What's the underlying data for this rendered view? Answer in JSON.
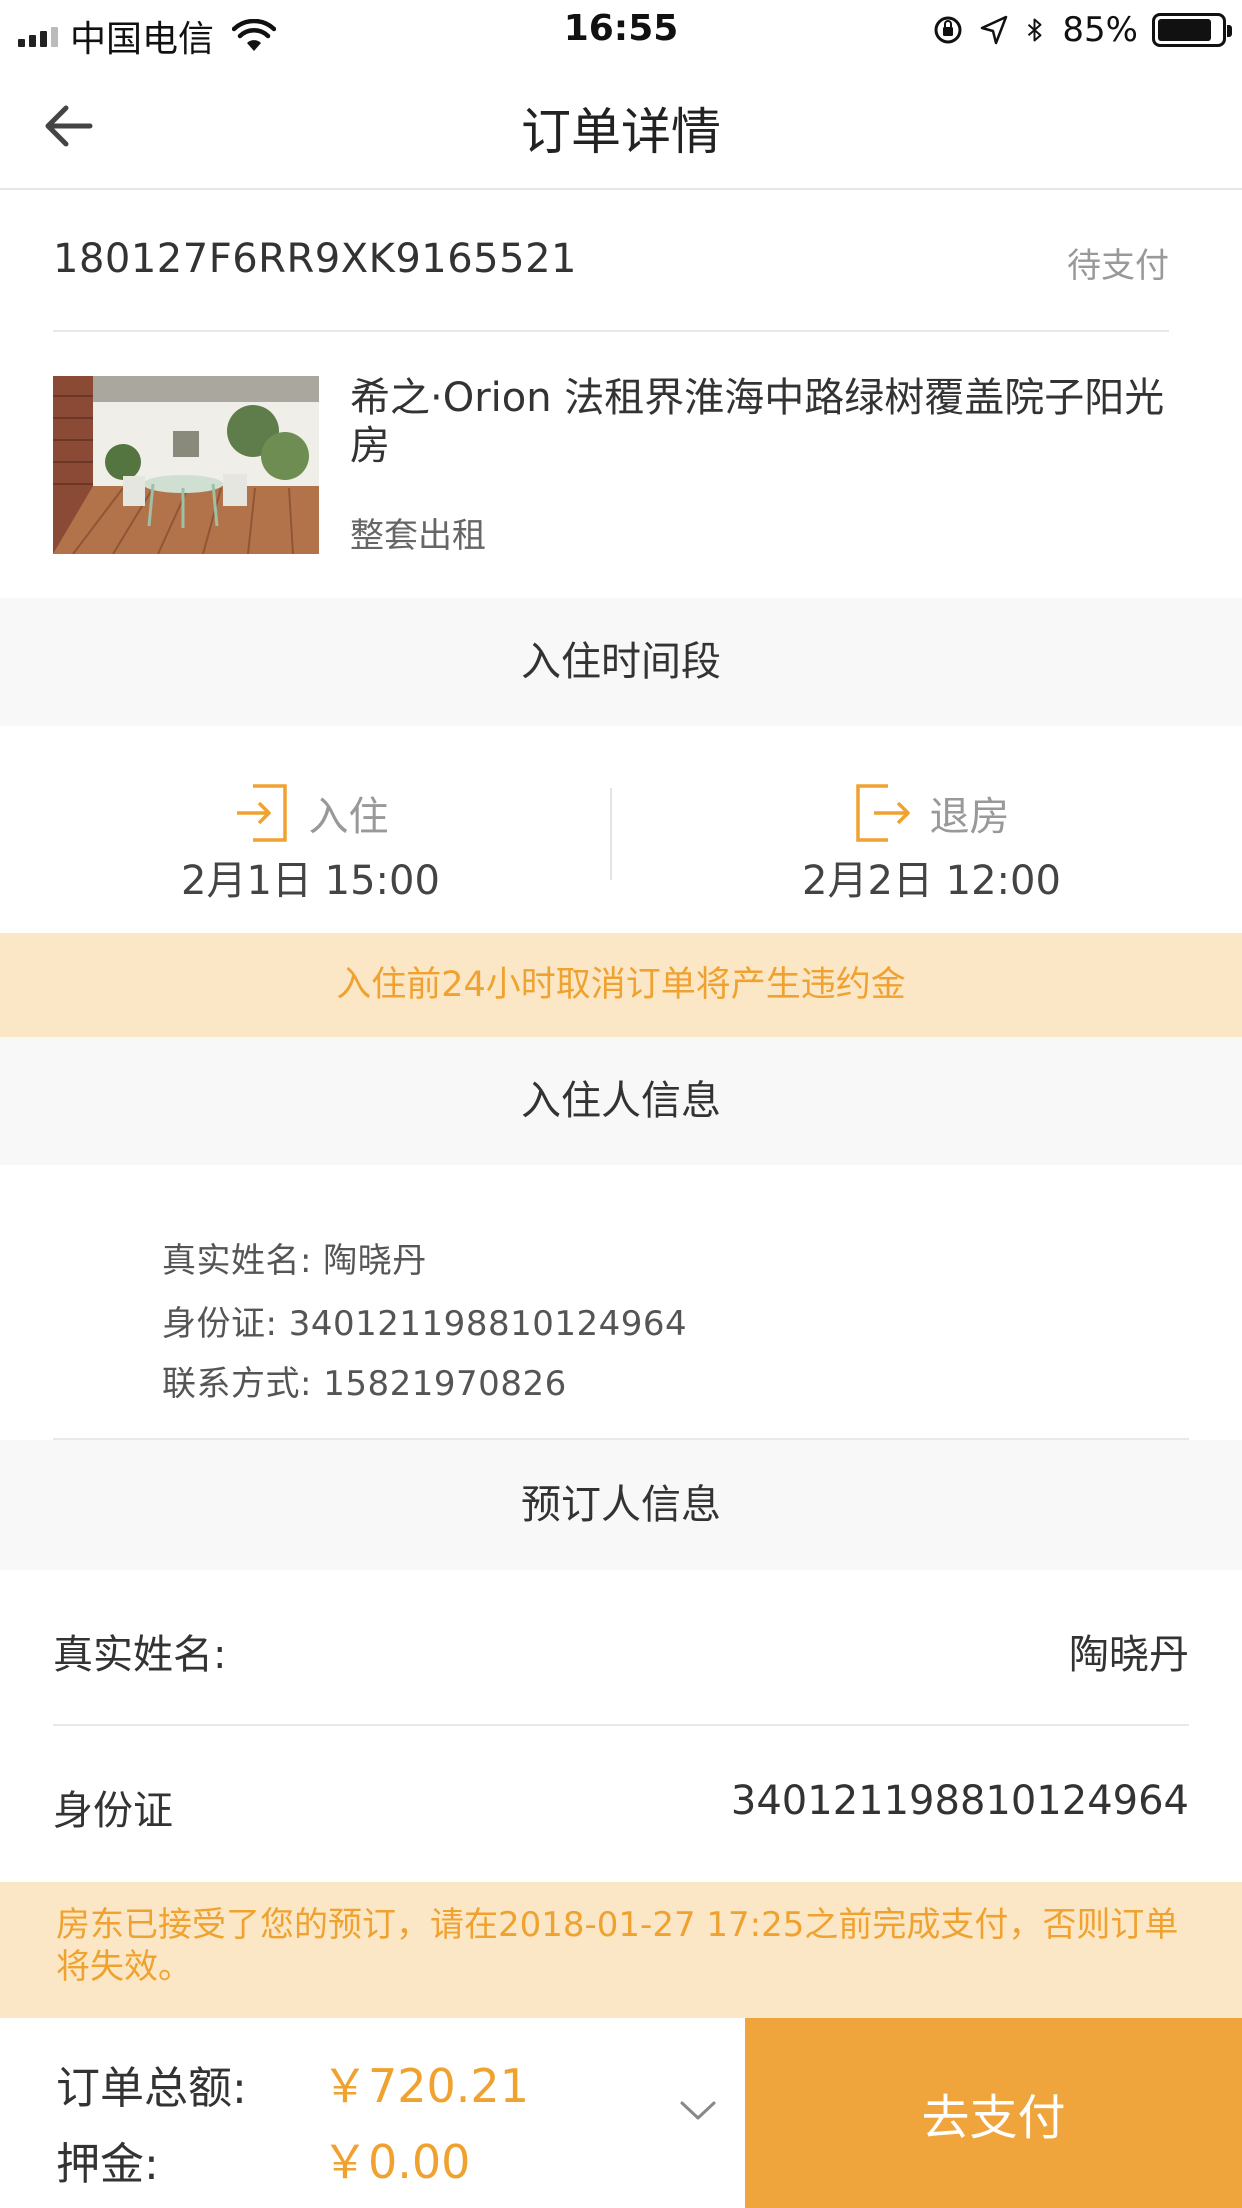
{
  "status_bar": {
    "carrier": "中国电信",
    "time": "16:55",
    "battery_percent": "85%",
    "battery_level": 0.85,
    "icons": [
      "signal-icon",
      "wifi-icon",
      "orientation-lock-icon",
      "location-icon",
      "bluetooth-icon",
      "battery-icon"
    ]
  },
  "nav": {
    "title": "订单详情",
    "back_icon": "arrow-left-icon"
  },
  "order": {
    "id": "180127F6RR9XK9165521",
    "status": "待支付"
  },
  "listing": {
    "title": "希之·Orion 法租界淮海中路绿树覆盖院子阳光房",
    "type": "整套出租"
  },
  "stay": {
    "section_title": "入住时间段",
    "checkin_label": "入住",
    "checkin_time": "2月1日 15:00",
    "checkout_label": "退房",
    "checkout_time": "2月2日 12:00"
  },
  "cancel_notice": "入住前24小时取消订单将产生违约金",
  "guest": {
    "section_title": "入住人信息",
    "name_line": "真实姓名: 陶晓丹",
    "id_line": "身份证: 340121198810124964",
    "phone_line": "联系方式: 15821970826"
  },
  "booker": {
    "section_title": "预订人信息",
    "name_label": "真实姓名:",
    "name_value": "陶晓丹",
    "id_label": "身份证",
    "id_value": "340121198810124964"
  },
  "payment_notice": "房东已接受了您的预订，请在2018-01-27 17:25之前完成支付，否则订单将失效。",
  "footer": {
    "total_label": "订单总额:",
    "total_value": "￥720.21",
    "deposit_label": "押金:",
    "deposit_value": "￥0.00",
    "pay_button": "去支付"
  },
  "colors": {
    "accent": "#f0a43c",
    "notice_bg": "#fbe7c6",
    "notice_text": "#f0a230",
    "section_bg": "#f8f8f8"
  }
}
